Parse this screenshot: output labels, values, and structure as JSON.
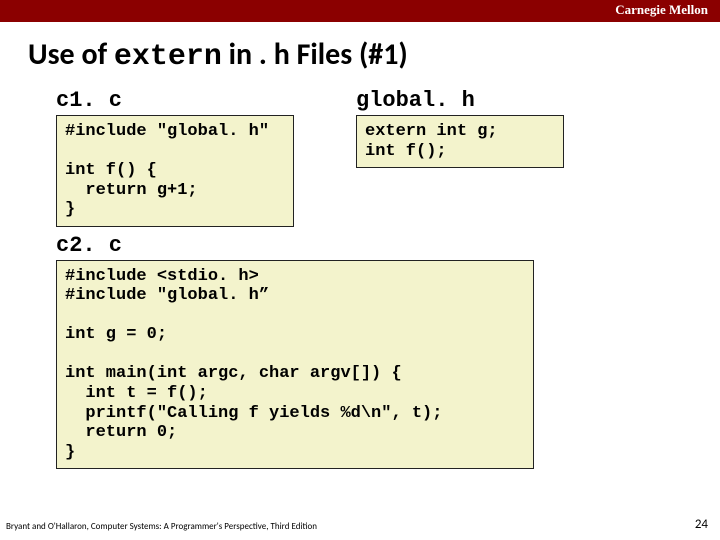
{
  "header": {
    "org": "Carnegie Mellon"
  },
  "title": {
    "prefix": "Use of ",
    "keyword": "extern",
    "suffix": " in . h Files (#1)"
  },
  "files": {
    "c1": {
      "name": "c1. c",
      "code": "#include \"global. h\"\n\nint f() {\n  return g+1;\n}"
    },
    "globalh": {
      "name": "global. h",
      "code": "extern int g;\nint f();"
    },
    "c2": {
      "name": "c2. c",
      "code": "#include <stdio. h>\n#include \"global. h”\n\nint g = 0;\n\nint main(int argc, char argv[]) {\n  int t = f();\n  printf(\"Calling f yields %d\\n\", t);\n  return 0;\n}"
    }
  },
  "footer": {
    "credit": "Bryant and O'Hallaron, Computer Systems: A Programmer's Perspective, Third Edition",
    "page": "24"
  }
}
